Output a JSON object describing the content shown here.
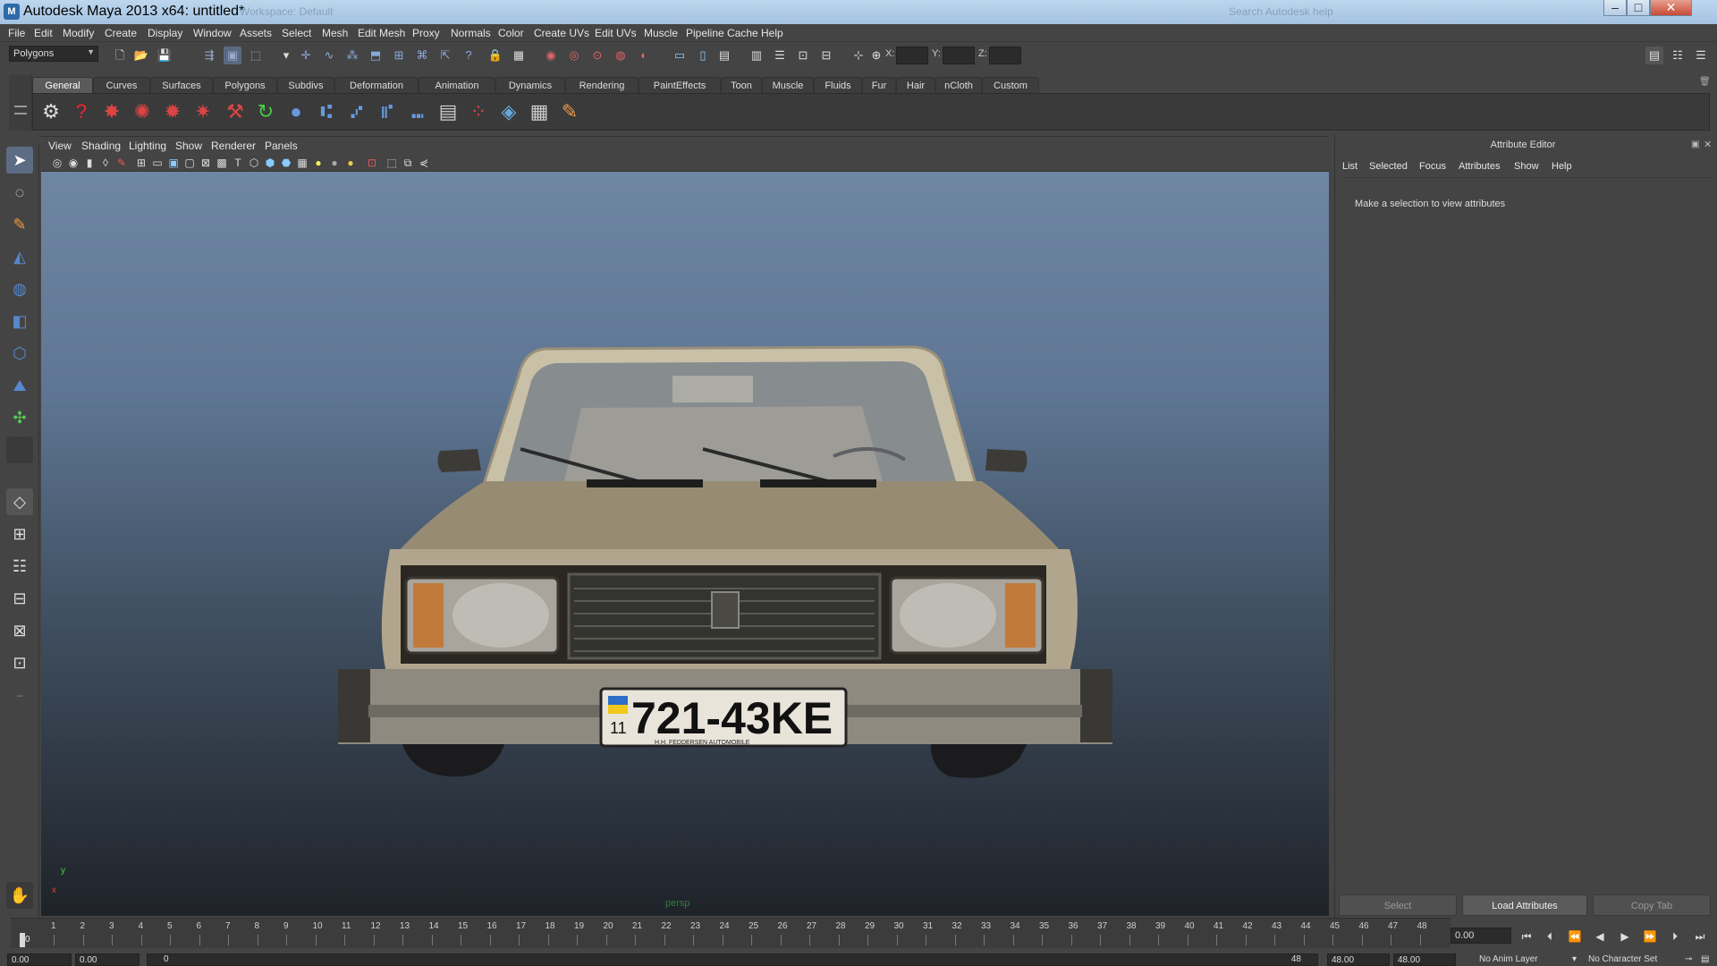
{
  "window": {
    "title": "Autodesk Maya 2013 x64: untitled*",
    "ghost_text_1": "Workspace: Default",
    "ghost_text_2": "Search Autodesk help",
    "buttons": {
      "minimize": "–",
      "maximize": "□",
      "close": "✕"
    }
  },
  "menubar": [
    "File",
    "Edit",
    "Modify",
    "Create",
    "Display",
    "Window",
    "Assets",
    "Select",
    "Mesh",
    "Edit Mesh",
    "Proxy",
    "Normals",
    "Color",
    "Create UVs",
    "Edit UVs",
    "Muscle",
    "Pipeline Cache",
    "Help"
  ],
  "statusline": {
    "mode": "Polygons",
    "coords": {
      "x_label": "X:",
      "y_label": "Y:",
      "z_label": "Z:"
    }
  },
  "shelf": {
    "tabs": [
      "General",
      "Curves",
      "Surfaces",
      "Polygons",
      "Subdivs",
      "Deformation",
      "Animation",
      "Dynamics",
      "Rendering",
      "PaintEffects",
      "Toon",
      "Muscle",
      "Fluids",
      "Fur",
      "Hair",
      "nCloth",
      "Custom"
    ],
    "active_tab": "General"
  },
  "viewport": {
    "menus": [
      "View",
      "Shading",
      "Lighting",
      "Show",
      "Renderer",
      "Panels"
    ],
    "camera": "persp",
    "axis": {
      "x": "x",
      "y": "y"
    },
    "license_plate": {
      "number": "721-43KE",
      "region": "11",
      "frame_text": "H.H. FEDDERSEN AUTOMOBILE"
    }
  },
  "attribute_editor": {
    "title": "Attribute Editor",
    "menus": [
      "List",
      "Selected",
      "Focus",
      "Attributes",
      "Show",
      "Help"
    ],
    "message": "Make a selection to view attributes",
    "buttons": [
      "Select",
      "Load Attributes",
      "Copy Tab"
    ]
  },
  "timeslider": {
    "frames": [
      1,
      2,
      3,
      4,
      5,
      6,
      7,
      8,
      9,
      10,
      11,
      12,
      13,
      14,
      15,
      16,
      17,
      18,
      19,
      20,
      21,
      22,
      23,
      24,
      25,
      26,
      27,
      28,
      29,
      30,
      31,
      32,
      33,
      34,
      35,
      36,
      37,
      38,
      39,
      40,
      41,
      42,
      43,
      44,
      45,
      46,
      47,
      48
    ],
    "current_frame": "0.00",
    "current_marker": "0"
  },
  "rangeslider": {
    "start_time": "0.00",
    "range_start": "0.00",
    "range_slider_start": "0",
    "range_slider_end": "48",
    "range_end": "48.00",
    "end_time": "48.00",
    "anim_layer": "No Anim Layer",
    "character_set": "No Character Set"
  }
}
